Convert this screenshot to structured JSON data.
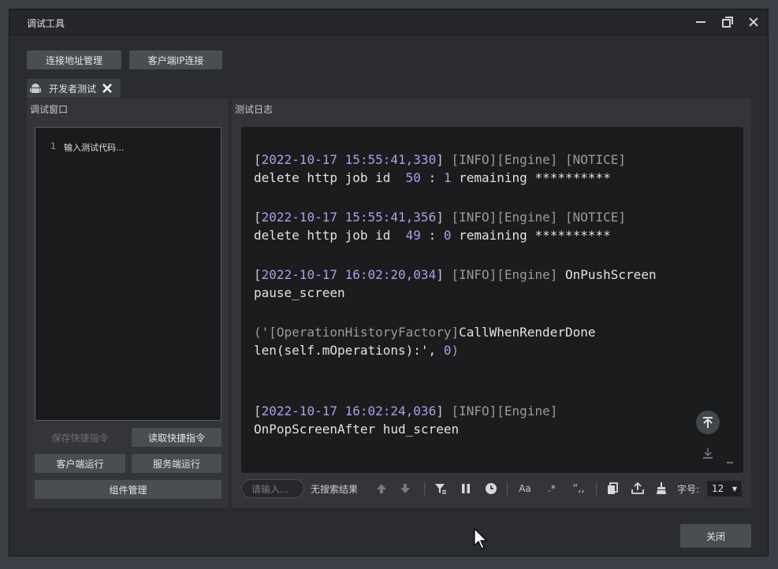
{
  "window": {
    "title": "调试工具"
  },
  "top_buttons": {
    "address_mgmt": "连接地址管理",
    "client_ip": "客户端IP连接"
  },
  "tab": {
    "label": "开发者测试"
  },
  "left_panel": {
    "header": "调试窗口",
    "line_number": "1",
    "code_placeholder": "输入测试代码...",
    "save_shortcut": "保存快捷指令",
    "read_shortcut": "读取快捷指令",
    "client_run": "客户端运行",
    "server_run": "服务端运行",
    "component_mgmt": "组件管理"
  },
  "right_panel": {
    "header": "测试日志",
    "logs": [
      {
        "ts": "2022-10-17 15:55:41,330",
        "level": "[INFO]",
        "engine": "[Engine]",
        "notice": "[NOTICE]",
        "line2_a": "delete http job id ",
        "id": "50",
        "sep": " : ",
        "remaining": "1",
        "line2_b": " remaining **********"
      },
      {
        "ts": "2022-10-17 15:55:41,356",
        "level": "[INFO]",
        "engine": "[Engine]",
        "notice": "[NOTICE]",
        "line2_a": "delete http job id ",
        "id": "49",
        "sep": " : ",
        "remaining": "0",
        "line2_b": " remaining **********"
      },
      {
        "ts": "2022-10-17 16:02:20,034",
        "level": "[INFO]",
        "engine": "[Engine]",
        "msg": "OnPushScreen",
        "line2": "pause_screen"
      },
      {
        "prefix": "('",
        "cls": "[OperationHistoryFactory]",
        "msg": "CallWhenRenderDone",
        "line2_a": "len(self.mOperations):', ",
        "val": "0",
        "line2_b": ")"
      },
      {
        "ts": "2022-10-17 16:02:24,036",
        "level": "[INFO]",
        "engine": "[Engine]",
        "line2": "OnPopScreenAfter hud_screen"
      }
    ],
    "search_placeholder": "请输入...",
    "no_result": "无搜索结果",
    "font_size_label": "字号:",
    "font_size_value": "12"
  },
  "footer": {
    "close": "关闭"
  },
  "icons": [
    "minimize-icon",
    "restore-icon",
    "close-icon",
    "android-icon",
    "tab-close-icon",
    "arrow-up-icon",
    "arrow-down-icon",
    "filter-icon",
    "pause-icon",
    "clock-icon",
    "match-case-icon",
    "regex-icon",
    "quote-icon",
    "copy-icon",
    "export-icon",
    "clear-icon",
    "scroll-top-icon",
    "scroll-bottom-icon",
    "cursor-icon"
  ],
  "colors": {
    "timestamp": "#a9a1e6",
    "window_bg": "#2a2c2f",
    "panel_bg": "#333539",
    "log_bg": "#1b1c1e"
  }
}
